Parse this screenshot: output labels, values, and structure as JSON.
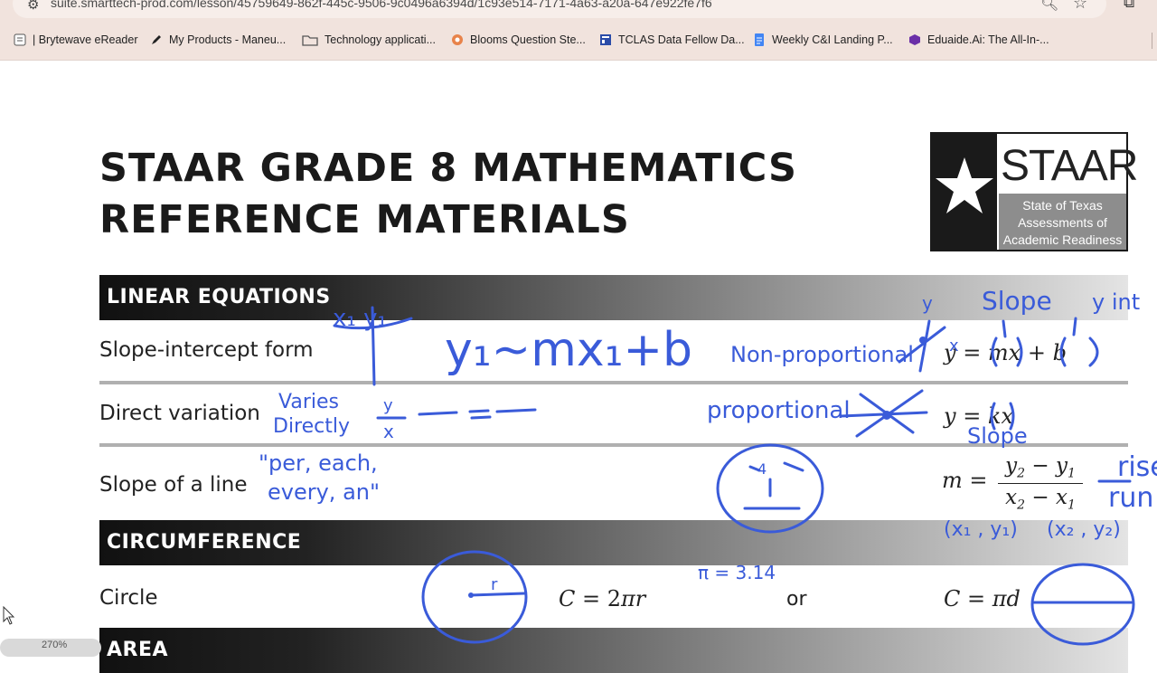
{
  "browser": {
    "url": "suite.smarttech-prod.com/lesson/45759649-862f-445c-9506-9c0496a6394d/1c93e514-7171-4a63-a20a-647e922fe7f6",
    "bookmarks": [
      {
        "label": "| Brytewave eReader",
        "icon": "ereader-icon"
      },
      {
        "label": "My Products - Maneu...",
        "icon": "pen-icon"
      },
      {
        "label": "Technology applicati...",
        "icon": "folder-icon"
      },
      {
        "label": "Blooms Question Ste...",
        "icon": "blooms-icon"
      },
      {
        "label": "TCLAS Data Fellow Da...",
        "icon": "dashboard-icon"
      },
      {
        "label": "Weekly C&I Landing P...",
        "icon": "doc-icon"
      },
      {
        "label": "Eduaide.Ai: The All-In-...",
        "icon": "eduaide-icon"
      }
    ],
    "zoom_label": "270%"
  },
  "document": {
    "title_line1": "STAAR GRADE 8 MATHEMATICS",
    "title_line2": "REFERENCE MATERIALS",
    "logo": {
      "wordmark": "STAAR",
      "sub1": "State of Texas",
      "sub2": "Assessments of",
      "sub3": "Academic Readiness"
    },
    "sections": {
      "linear": "LINEAR EQUATIONS",
      "circumference": "CIRCUMFERENCE",
      "area": "AREA"
    },
    "rows": {
      "slope_intercept": "Slope-intercept form",
      "direct_variation": "Direct variation",
      "slope_line": "Slope of a line",
      "circle": "Circle"
    },
    "formulas": {
      "or": "or"
    }
  },
  "annotations": {
    "x1y1": "x₁ y₁",
    "y1_eq": "y₁~mx₁+b",
    "non_proportional": "Non-proportional",
    "y_small": "y",
    "x_small": "x",
    "slope_top": "Slope",
    "y_int": "y int",
    "varies": "Varies",
    "directly": "Directly",
    "y_over": "y",
    "x_under": "x",
    "proportional": "proportional",
    "slope_mid": "Slope",
    "per_each": "\"per, each,",
    "every_an": "every, an\"",
    "rise": "rise",
    "run": "run",
    "pt1": "(x₁ , y₁)",
    "pt2": "(x₂ , y₂)",
    "r": "r",
    "pi": "π = 3.14",
    "face_num": "4"
  },
  "colors": {
    "ink": "#3a5bd9",
    "band_dark": "#111111"
  }
}
